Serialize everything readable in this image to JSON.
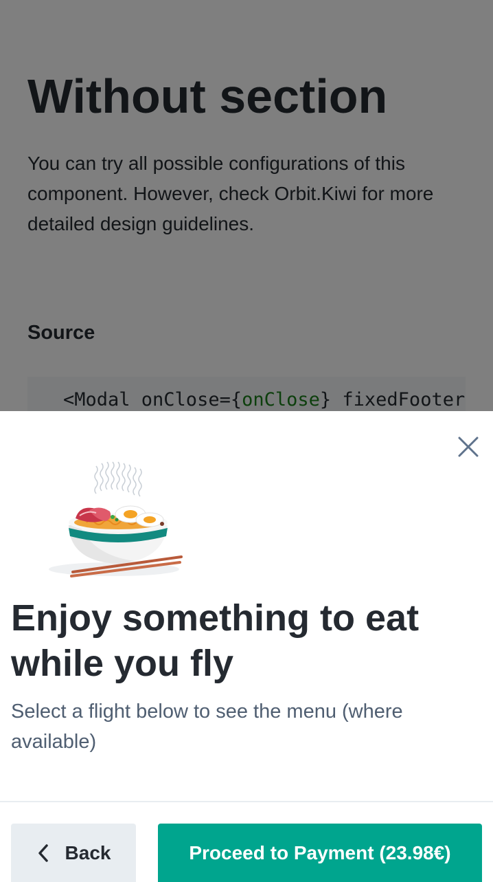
{
  "page": {
    "title": "Without section",
    "intro": "You can try all possible configurations of this component. However, check Orbit.Kiwi for more detailed design guidelines.",
    "source_heading": "Source",
    "code": {
      "tag_open": "<Modal onClose={",
      "prop_value": "onClose",
      "tag_rest": "} fixedFooter>"
    }
  },
  "modal": {
    "close_icon": "close-icon",
    "illustration": "noodle-bowl-illustration",
    "title": "Enjoy something to eat while you fly",
    "description": "Select a flight below to see the menu (where available)",
    "footer": {
      "back_label": "Back",
      "back_icon": "chevron-left-icon",
      "proceed_label": "Proceed to Payment (23.98€)"
    }
  },
  "colors": {
    "primary": "#00a58e",
    "secondary_button": "#e8edf1",
    "ink": "#252a31",
    "ink_secondary": "#4f5e71",
    "close_icon": "#5f738c",
    "overlay": "rgba(0,0,0,0.5)"
  }
}
